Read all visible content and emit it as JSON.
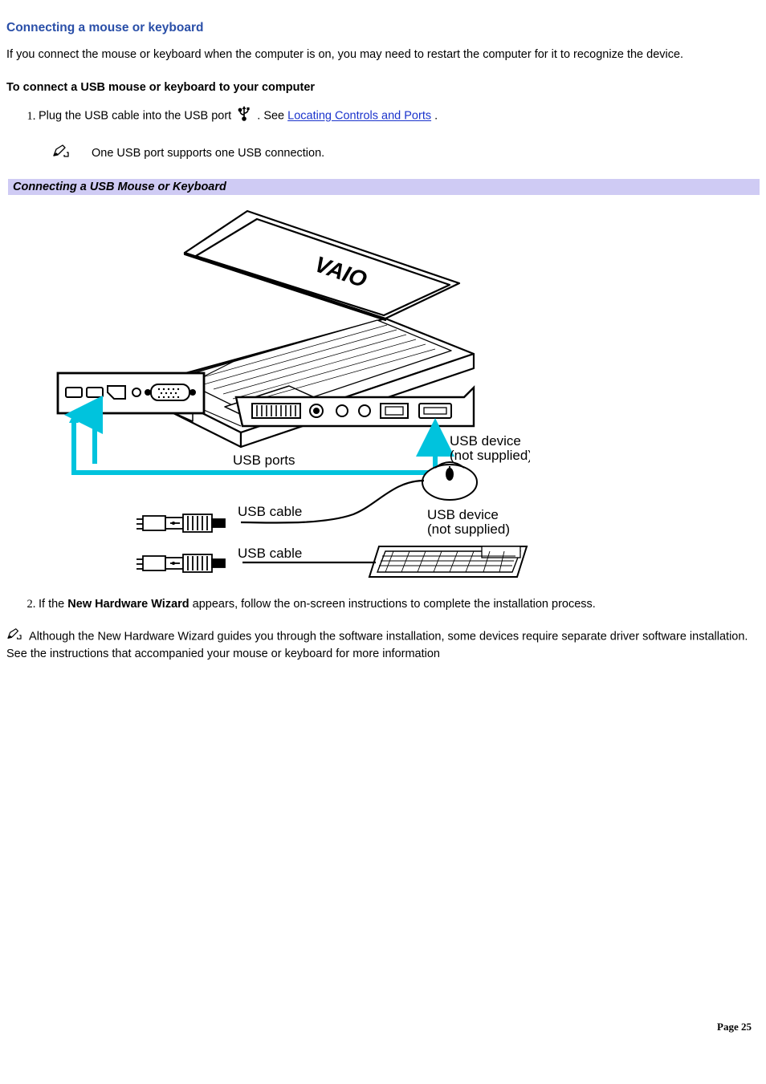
{
  "heading": "Connecting a mouse or keyboard",
  "intro": "If you connect the mouse or keyboard when the computer is on, you may need to restart the computer for it to recognize the device.",
  "subhead": "To connect a USB mouse or keyboard to your computer",
  "step1_part1": "Plug the USB cable into the USB port ",
  "step1_part2": ". See ",
  "step1_link": "Locating Controls and Ports",
  "step1_part3": ".",
  "step1_note": "One USB port supports one USB connection.",
  "banner_title": "Connecting a USB Mouse or Keyboard",
  "diagram": {
    "laptop_logo": "VAIO",
    "label_usb_ports": "USB ports",
    "label_usb_cable": "USB cable",
    "label_usb_device": "USB device",
    "label_not_supplied": "(not supplied)"
  },
  "step2_part1": "If the ",
  "step2_bold": "New Hardware Wizard",
  "step2_part2": " appears, follow the on-screen instructions to complete the installation process.",
  "footnote": "Although the New Hardware Wizard guides you through the software installation, some devices require separate driver software installation. See the instructions that accompanied your mouse or keyboard for more information",
  "page_label": "Page 25"
}
